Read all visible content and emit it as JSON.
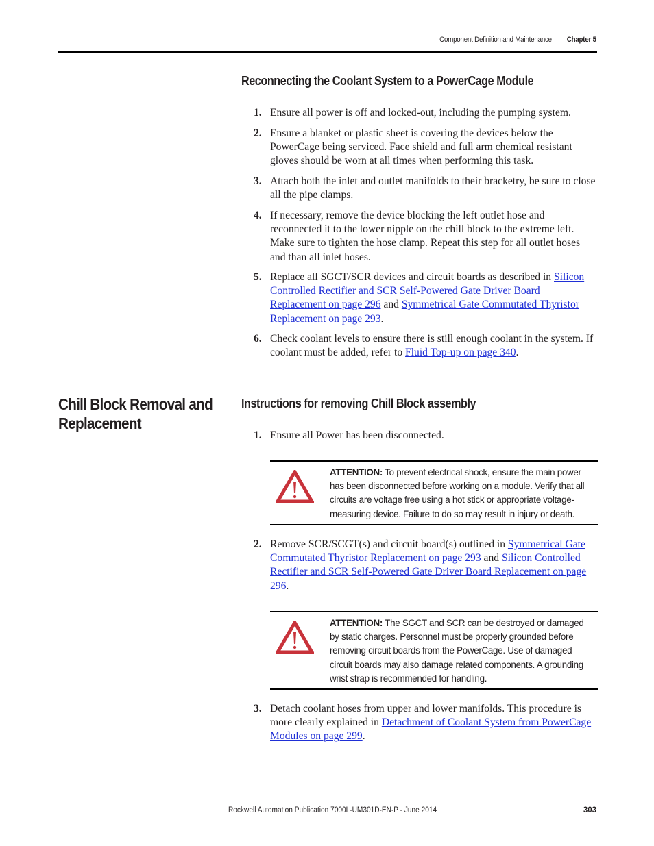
{
  "header": {
    "section_title": "Component Definition and Maintenance",
    "chapter": "Chapter 5"
  },
  "section1": {
    "heading": "Reconnecting the Coolant System to a PowerCage Module",
    "steps": [
      {
        "num": "1.",
        "text": "Ensure all power is off and locked-out, including the pumping system."
      },
      {
        "num": "2.",
        "text": "Ensure a blanket or plastic sheet is covering the devices below the PowerCage being serviced. Face shield and full arm chemical resistant gloves should be worn at all times when performing this task."
      },
      {
        "num": "3.",
        "text": "Attach both the inlet and outlet manifolds to their bracketry, be sure to close all the pipe clamps."
      },
      {
        "num": "4.",
        "text": "If necessary, remove the device blocking the left outlet hose and reconnected it to the lower nipple on the chill block to the extreme left. Make sure to tighten the hose clamp. Repeat this step for all outlet hoses and than all inlet hoses."
      },
      {
        "num": "5.",
        "pre": "Replace all SGCT/SCR devices and circuit boards as described in ",
        "link1": "Silicon Controlled Rectifier and SCR Self-Powered Gate Driver Board Replacement on page 296",
        "mid": " and ",
        "link2": "Symmetrical Gate Commutated Thyristor Replacement on page 293",
        "post": "."
      },
      {
        "num": "6.",
        "pre": "Check coolant levels to ensure there is still enough coolant in the system. If coolant must be added, refer to ",
        "link1": "Fluid Top-up on page 340",
        "post": "."
      }
    ]
  },
  "side_heading": "Chill Block Removal and Replacement",
  "section2": {
    "heading": "Instructions for removing Chill Block assembly",
    "steps": [
      {
        "num": "1.",
        "text": "Ensure all Power has been disconnected."
      },
      {
        "num": "2.",
        "pre": "Remove SCR/SCGT(s) and circuit board(s) outlined in ",
        "link1": "Symmetrical Gate Commutated Thyristor Replacement on page 293",
        "mid": " and ",
        "link2": "Silicon Controlled Rectifier and SCR Self-Powered Gate Driver Board Replacement on page 296",
        "post": "."
      },
      {
        "num": "3.",
        "pre": "Detach coolant hoses from upper and lower manifolds. This procedure is more clearly explained in ",
        "link1": "Detachment of Coolant System from PowerCage Modules on page 299",
        "post": "."
      }
    ],
    "attention1": {
      "label": "ATTENTION:",
      "text": " To prevent electrical shock, ensure the main power has been disconnected before working on a module. Verify that all circuits are voltage free using a hot stick or appropriate voltage-measuring device. Failure to do so may result in injury or death.",
      "icon": "warning-triangle-icon"
    },
    "attention2": {
      "label": "ATTENTION:",
      "text": " The SGCT and SCR can be destroyed or damaged by static charges. Personnel must be properly grounded before removing circuit boards from the PowerCage. Use of damaged circuit boards may also damage related components. A grounding wrist strap is recommended for handling.",
      "icon": "warning-triangle-icon"
    }
  },
  "footer": {
    "publication": "Rockwell Automation Publication 7000L-UM301D-EN-P - June 2014",
    "page_number": "303"
  },
  "colors": {
    "link": "#1f2fd6",
    "warning": "#c8323a",
    "text": "#231f20"
  }
}
